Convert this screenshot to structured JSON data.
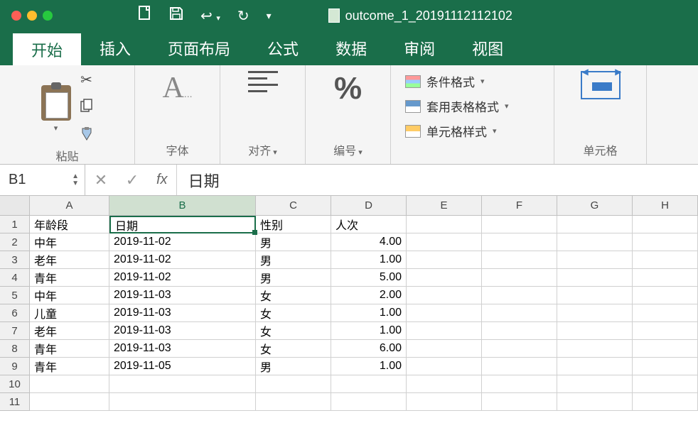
{
  "titlebar": {
    "document_name": "outcome_1_20191112112102"
  },
  "ribbon_tabs": [
    {
      "label": "开始",
      "active": true
    },
    {
      "label": "插入",
      "active": false
    },
    {
      "label": "页面布局",
      "active": false
    },
    {
      "label": "公式",
      "active": false
    },
    {
      "label": "数据",
      "active": false
    },
    {
      "label": "审阅",
      "active": false
    },
    {
      "label": "视图",
      "active": false
    }
  ],
  "ribbon": {
    "paste_label": "粘贴",
    "font_label": "字体",
    "align_label": "对齐",
    "number_label": "编号",
    "cond_format_label": "条件格式",
    "table_format_label": "套用表格格式",
    "cell_style_label": "单元格样式",
    "cells_label": "单元格"
  },
  "formula_bar": {
    "name_box": "B1",
    "fx": "fx",
    "value": "日期"
  },
  "columns": [
    "A",
    "B",
    "C",
    "D",
    "E",
    "F",
    "G",
    "H"
  ],
  "rows": [
    {
      "n": 1,
      "a": "年龄段",
      "b": "日期",
      "c": "性别",
      "d": "人次",
      "d_num": false,
      "active_b": true
    },
    {
      "n": 2,
      "a": "中年",
      "b": "2019-11-02",
      "c": "男",
      "d": "4.00",
      "d_num": true
    },
    {
      "n": 3,
      "a": "老年",
      "b": "2019-11-02",
      "c": "男",
      "d": "1.00",
      "d_num": true
    },
    {
      "n": 4,
      "a": "青年",
      "b": "2019-11-02",
      "c": "男",
      "d": "5.00",
      "d_num": true
    },
    {
      "n": 5,
      "a": "中年",
      "b": "2019-11-03",
      "c": "女",
      "d": "2.00",
      "d_num": true
    },
    {
      "n": 6,
      "a": "儿童",
      "b": "2019-11-03",
      "c": "女",
      "d": "1.00",
      "d_num": true
    },
    {
      "n": 7,
      "a": "老年",
      "b": "2019-11-03",
      "c": "女",
      "d": "1.00",
      "d_num": true
    },
    {
      "n": 8,
      "a": "青年",
      "b": "2019-11-03",
      "c": "女",
      "d": "6.00",
      "d_num": true
    },
    {
      "n": 9,
      "a": "青年",
      "b": "2019-11-05",
      "c": "男",
      "d": "1.00",
      "d_num": true
    },
    {
      "n": 10,
      "a": "",
      "b": "",
      "c": "",
      "d": "",
      "d_num": false
    },
    {
      "n": 11,
      "a": "",
      "b": "",
      "c": "",
      "d": "",
      "d_num": false
    }
  ],
  "active_cell": {
    "row": 1,
    "col": "B"
  }
}
